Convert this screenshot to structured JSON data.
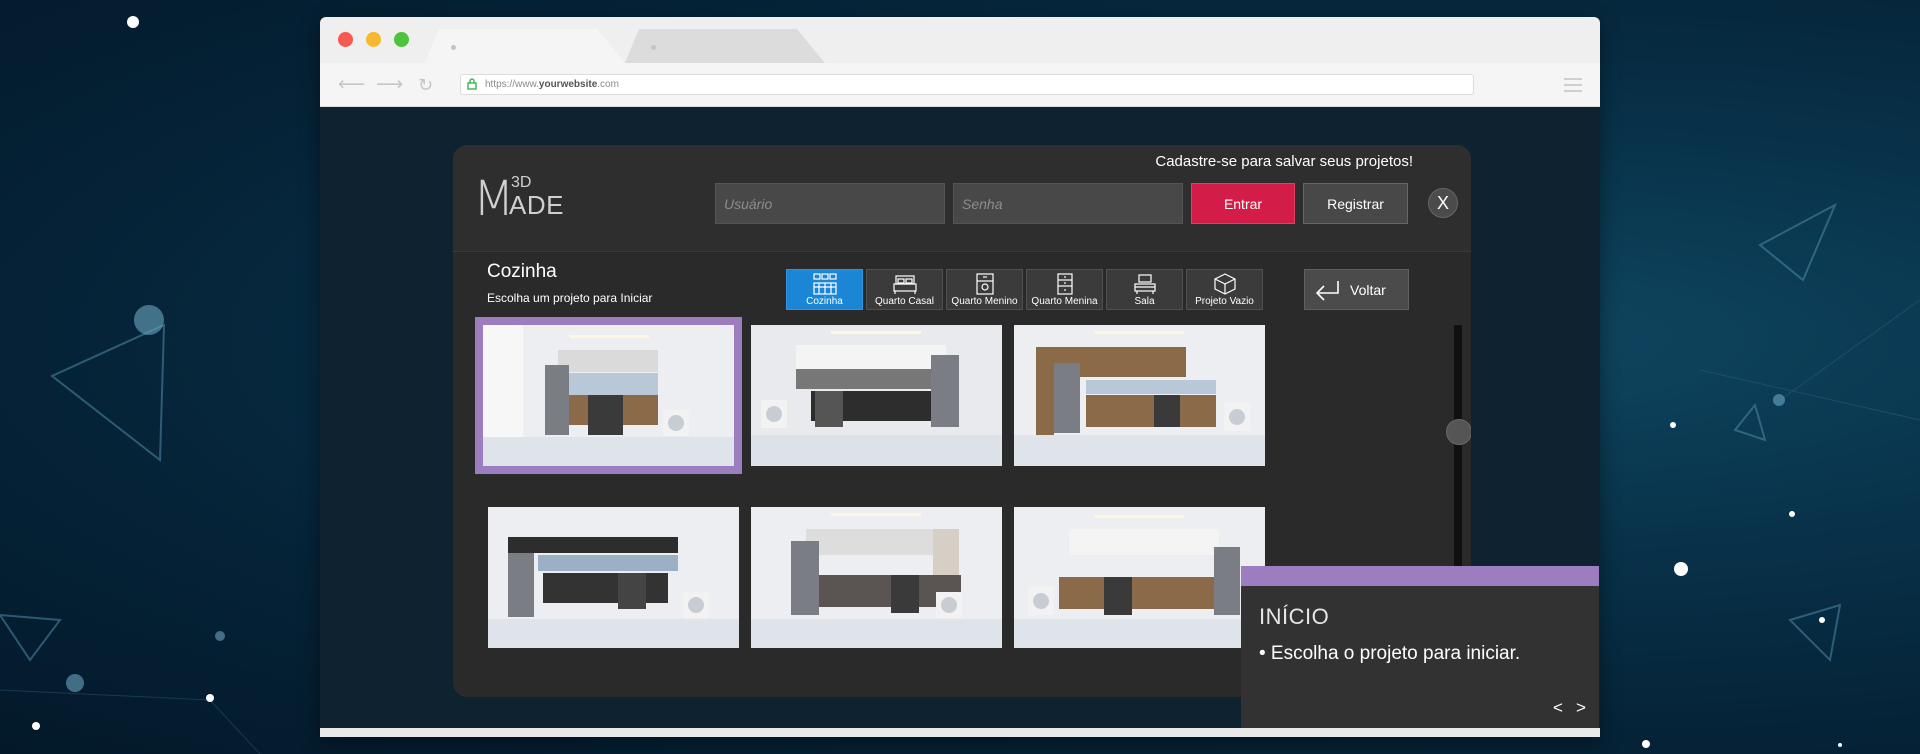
{
  "browser": {
    "url_prefix": "https://www.",
    "url_domain": "yourwebsite",
    "url_suffix": ".com",
    "nav_back_icon": "arrow-left-icon",
    "nav_forward_icon": "arrow-right-icon",
    "reload_icon": "reload-icon"
  },
  "header": {
    "logo_3d": "3D",
    "logo_m": "M",
    "logo_ade": "ADE",
    "signup_prompt": "Cadastre-se para salvar seus projetos!",
    "username_placeholder": "Usuário",
    "password_placeholder": "Senha",
    "login_label": "Entrar",
    "register_label": "Registrar",
    "close_label": "X"
  },
  "section": {
    "title": "Cozinha",
    "subtitle": "Escolha um projeto para Iniciar"
  },
  "categories": [
    {
      "label": "Cozinha",
      "icon": "kitchen-icon",
      "active": true
    },
    {
      "label": "Quarto Casal",
      "icon": "double-bed-icon",
      "active": false
    },
    {
      "label": "Quarto Menino",
      "icon": "boy-room-icon",
      "active": false
    },
    {
      "label": "Quarto Menina",
      "icon": "girl-room-icon",
      "active": false
    },
    {
      "label": "Sala",
      "icon": "living-room-icon",
      "active": false
    },
    {
      "label": "Projeto Vazio",
      "icon": "empty-box-icon",
      "active": false
    }
  ],
  "back_button": {
    "label": "Voltar",
    "icon": "back-arrow-icon"
  },
  "projects": [
    {
      "selected": true
    },
    {
      "selected": false
    },
    {
      "selected": false
    },
    {
      "selected": false
    },
    {
      "selected": false
    },
    {
      "selected": false
    }
  ],
  "tip": {
    "title": "INÍCIO",
    "text": "• Escolha o projeto para iniciar.",
    "prev": "<",
    "next": ">"
  },
  "colors": {
    "accent_purple": "#9b7dc0",
    "login_red": "#d31c47",
    "active_blue": "#1b86d6"
  }
}
